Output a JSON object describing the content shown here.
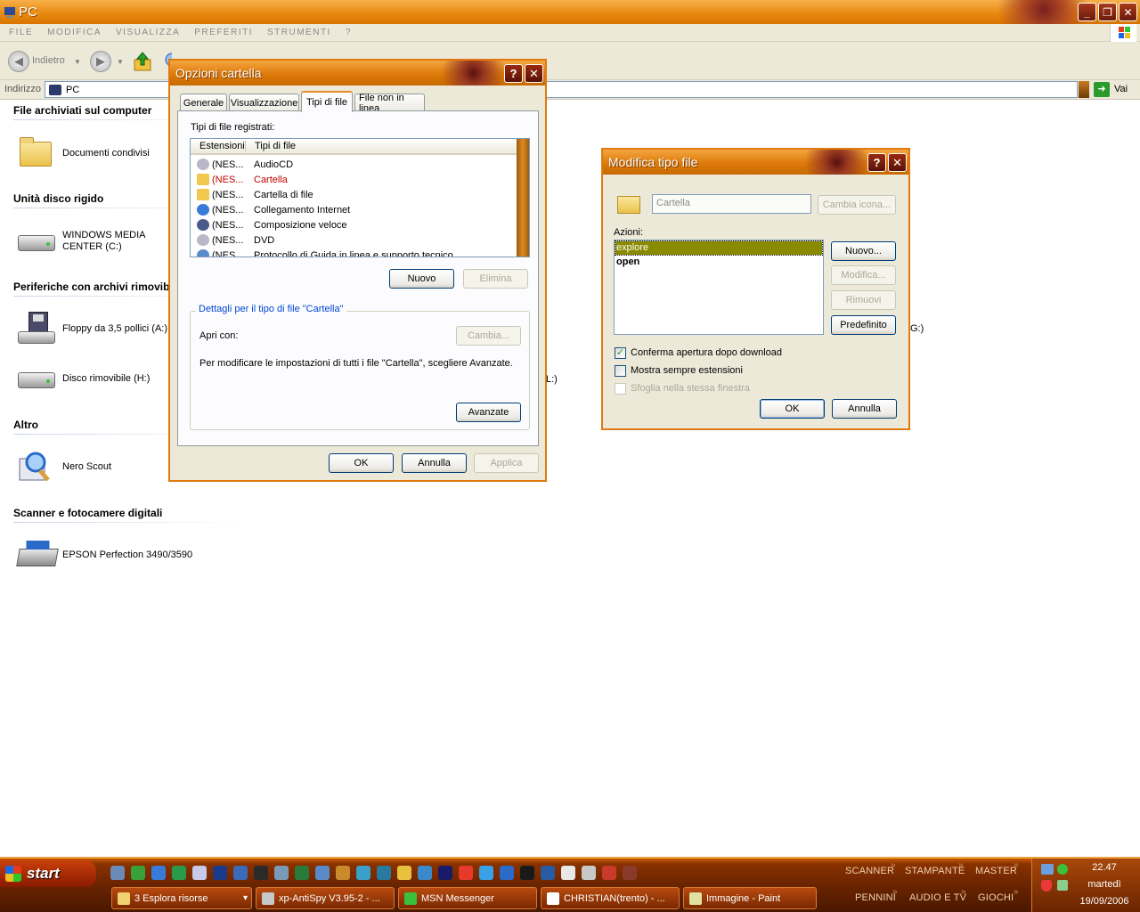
{
  "window": {
    "title": "PC"
  },
  "menu": [
    "FILE",
    "MODIFICA",
    "VISUALIZZA",
    "PREFERITI",
    "STRUMENTI",
    "?"
  ],
  "toolbar": {
    "back_label": "Indietro"
  },
  "address": {
    "label": "Indirizzo",
    "value": "PC",
    "go_label": "Vai"
  },
  "content": {
    "sections": {
      "archived": "File archiviati sul computer",
      "hdd": "Unità disco rigido",
      "removable": "Periferiche con archivi rimovibili",
      "other": "Altro",
      "scanners": "Scanner e fotocamere digitali"
    },
    "items": {
      "shared_docs": "Documenti condivisi",
      "windows_media_center": "WINDOWS MEDIA CENTER (C:)",
      "floppy": "Floppy da 3,5 pollici (A:)",
      "removable_h": "Disco rimovibile (H:)",
      "nero_scout": "Nero Scout",
      "epson": "EPSON Perfection 3490/3590"
    },
    "hidden_fragments": {
      "g_drive": "G:)",
      "l_drive": "L:)"
    }
  },
  "folder_options": {
    "title": "Opzioni cartella",
    "tabs": [
      "Generale",
      "Visualizzazione",
      "Tipi di file",
      "File non in linea"
    ],
    "active_tab": "Tipi di file",
    "registered_label": "Tipi di file registrati:",
    "columns": [
      "Estensioni",
      "Tipi di file"
    ],
    "rows": [
      {
        "ext": "(NES...",
        "type": "AudioCD",
        "icon": "cd-icon",
        "selected": false
      },
      {
        "ext": "(NES...",
        "type": "Cartella",
        "icon": "folder-icon",
        "selected": true
      },
      {
        "ext": "(NES...",
        "type": "Cartella di file",
        "icon": "folder-icon",
        "selected": false
      },
      {
        "ext": "(NES...",
        "type": "Collegamento Internet",
        "icon": "ie-icon",
        "selected": false
      },
      {
        "ext": "(NES...",
        "type": "Composizione veloce",
        "icon": "computer-icon",
        "selected": false
      },
      {
        "ext": "(NES...",
        "type": "DVD",
        "icon": "cd-icon",
        "selected": false
      },
      {
        "ext": "(NES...",
        "type": "Protocollo di Guida in linea e supporto tecnico",
        "icon": "help-icon",
        "selected": false
      }
    ],
    "new_label": "Nuovo",
    "delete_label": "Elimina",
    "details_title": "Dettagli per il tipo di file \"Cartella\"",
    "open_with_label": "Apri con:",
    "change_label": "Cambia...",
    "info_text": "Per modificare le impostazioni di tutti i file \"Cartella\", scegliere Avanzate.",
    "advanced_label": "Avanzate",
    "ok_label": "OK",
    "cancel_label": "Annulla",
    "apply_label": "Applica",
    "help_label": "?",
    "close_label": "✕"
  },
  "edit_type": {
    "title": "Modifica tipo file",
    "name_value": "Cartella",
    "change_icon_label": "Cambia icona...",
    "actions_label": "Azioni:",
    "actions": [
      {
        "label": "explore",
        "selected": true,
        "bold": false
      },
      {
        "label": "open",
        "selected": false,
        "bold": true
      }
    ],
    "new_label": "Nuovo...",
    "edit_label": "Modifica...",
    "remove_label": "Rimuovi",
    "default_label": "Predefinito",
    "checks": [
      {
        "label": "Conferma apertura dopo download",
        "checked": true,
        "disabled": false
      },
      {
        "label": "Mostra sempre estensioni",
        "checked": false,
        "disabled": false
      },
      {
        "label": "Sfoglia nella stessa finestra",
        "checked": false,
        "disabled": true
      }
    ],
    "ok_label": "OK",
    "cancel_label": "Annulla",
    "help_label": "?",
    "close_label": "✕"
  },
  "taskbar": {
    "start_label": "start",
    "tasks": [
      {
        "label": "3 Esplora risorse",
        "color": "#f0d070"
      },
      {
        "label": "xp-AntiSpy V3.95-2 - ...",
        "color": "#c8c8c8"
      },
      {
        "label": "MSN Messenger",
        "color": "#3ac03a"
      },
      {
        "label": "CHRISTIAN(trento) - ...",
        "color": "#ffffff"
      },
      {
        "label": "Immagine - Paint",
        "color": "#e0e0a0"
      }
    ],
    "links_top": [
      "SCANNER",
      "STAMPANTE",
      "MASTER"
    ],
    "links_bottom": [
      "PENNINI",
      "AUDIO E TV",
      "GIOCHI"
    ],
    "clock": {
      "time": "22.47",
      "day": "martedì",
      "date": "19/09/2006"
    }
  },
  "colors": {
    "accent": "#e07a10",
    "selected_text": "#c00000",
    "selected_action_bg": "#8a8a00"
  }
}
